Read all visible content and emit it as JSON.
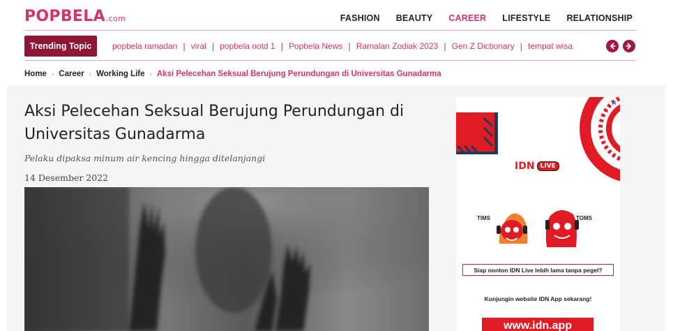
{
  "logo": {
    "brand": "POPBELA",
    "suffix": ".com"
  },
  "nav": [
    {
      "label": "FASHION"
    },
    {
      "label": "BEAUTY"
    },
    {
      "label": "CAREER"
    },
    {
      "label": "LIFESTYLE"
    },
    {
      "label": "RELATIONSHIP"
    }
  ],
  "trending": {
    "label": "Trending Topic",
    "topics": [
      "popbela ramadan",
      "viral",
      "popbela ootd 1",
      "Popbela News",
      "Ramalan Zodiak 2023",
      "Gen Z Dictionary",
      "tempat wisa"
    ],
    "separator": "|",
    "prev_icon": "arrow-left-icon",
    "next_icon": "arrow-right-icon"
  },
  "breadcrumb": {
    "items": [
      "Home",
      "Career",
      "Working Life",
      "Aksi Pelecehan Seksual Berujung Perundungan di Universitas Gunadarma"
    ],
    "separator": "›"
  },
  "article": {
    "title": "Aksi Pelecehan Seksual Berujung Perundungan di Universitas Gunadarma",
    "subtitle": "Pelaku dipaksa minum air kencing hingga ditelanjangi",
    "date": "14 Desember 2022"
  },
  "ad": {
    "close": "×",
    "brand": "IDN",
    "live": "LIVE",
    "mascot_left": "TIMS",
    "mascot_right": "TOMS",
    "promo": "Siap nonton IDN Live lebih lama tanpa pegel?",
    "cta": "Kunjungin website IDN App sekarang!",
    "button": "www.idn.app"
  },
  "colors": {
    "brand_pink": "#d6336c",
    "trending_bg": "#8e1536",
    "arrow_bg": "#a01945",
    "ad_red": "#e01b24"
  }
}
